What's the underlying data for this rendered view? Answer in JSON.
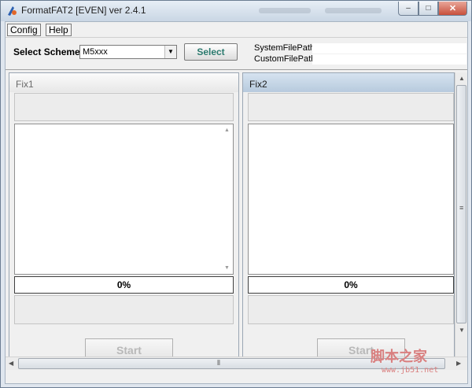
{
  "window": {
    "title": "FormatFAT2 [EVEN] ver 2.4.1",
    "close_glyph": "✕",
    "min_glyph": "–",
    "max_glyph": "□"
  },
  "menu": {
    "items": [
      {
        "label": "Config"
      },
      {
        "label": "Help"
      }
    ]
  },
  "toolbar": {
    "scheme_label": "Select Scheme",
    "scheme_value": "M5xxx",
    "select_label": "Select",
    "system_path_label": "SystemFilePath",
    "custom_path_label": "CustomFilePath",
    "system_path_value": "",
    "custom_path_value": ""
  },
  "panels": [
    {
      "title": "Fix1",
      "progress": "0%",
      "start_label": "Start"
    },
    {
      "title": "Fix2",
      "progress": "0%",
      "start_label": "Start"
    }
  ],
  "watermark": {
    "text": "脚本之家",
    "url": "www.jb51.net"
  },
  "colors": {
    "select_button_text": "#2b7a6e",
    "active_panel_header": "#b7cadd",
    "close_button": "#c8503c"
  }
}
